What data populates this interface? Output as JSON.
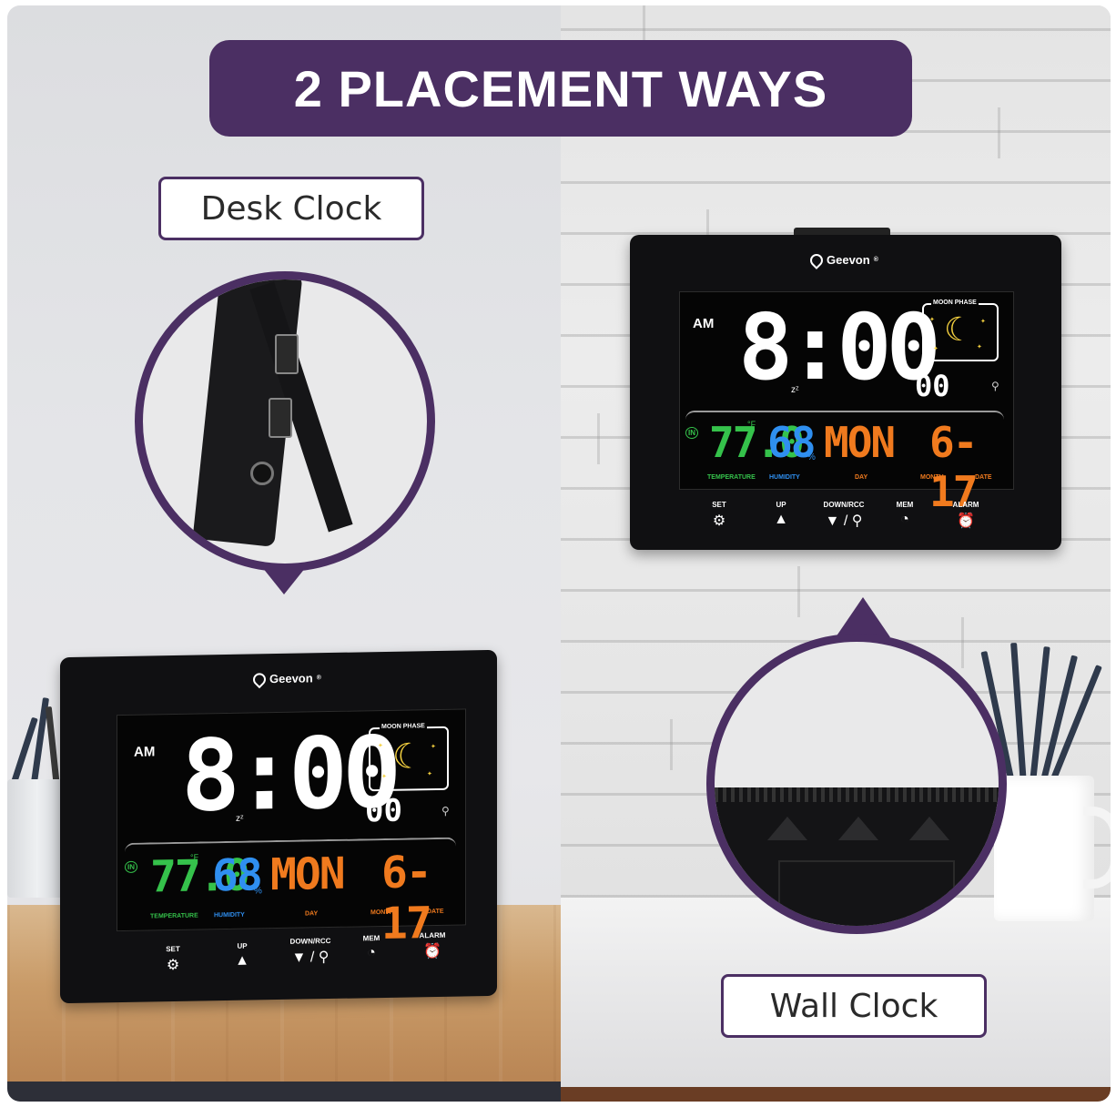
{
  "banner": {
    "title": "2 PLACEMENT WAYS"
  },
  "labels": {
    "desk": "Desk Clock",
    "wall": "Wall Clock"
  },
  "clock_display": {
    "brand": "Geevon",
    "registered": "®",
    "ampm": "AM",
    "time": "8:00",
    "seconds": "00",
    "snooze": "zᶻ",
    "moon_phase_label": "MOON PHASE",
    "indoor_badge": "IN",
    "temperature": "77.0",
    "temp_unit": "°F",
    "humidity": "68",
    "humidity_unit": "%",
    "day": "MON",
    "date_display": "6-17",
    "sub_labels": {
      "temperature": "TEMPERATURE",
      "humidity": "HUMIDITY",
      "day": "DAY",
      "month": "MONTH",
      "date": "DATE"
    },
    "buttons": {
      "set": "SET",
      "up": "UP",
      "down": "DOWN/RCC",
      "mem": "MEM",
      "alarm": "ALARM"
    }
  },
  "colors": {
    "banner": "#4b2f63",
    "temperature": "#35c24b",
    "humidity": "#2f8ff0",
    "day_date": "#f07a1e"
  },
  "icons": [
    "gear-icon",
    "up-triangle-icon",
    "down-triangle-icon",
    "satellite-icon",
    "gauge-icon",
    "alarm-clock-icon",
    "moon-icon",
    "house-icon"
  ]
}
